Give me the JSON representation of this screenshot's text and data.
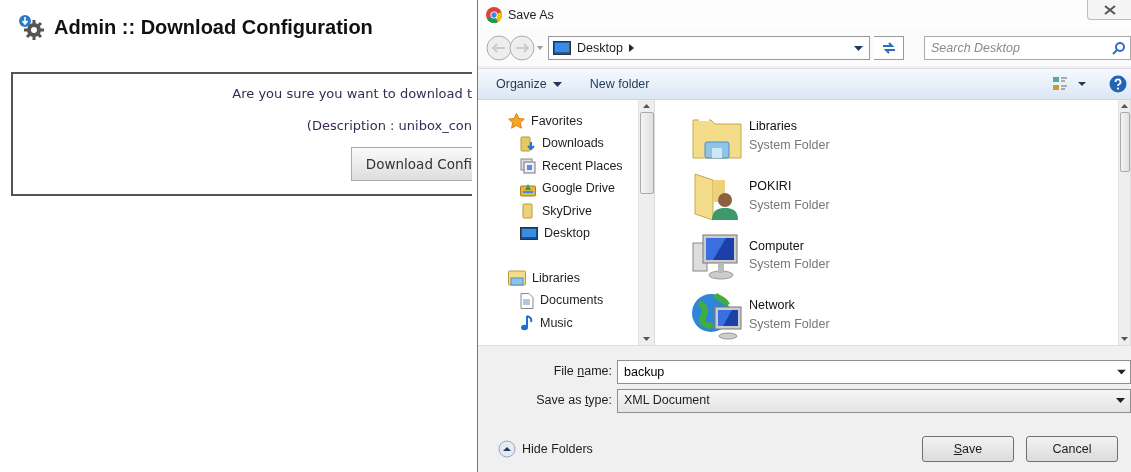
{
  "page": {
    "title": "Admin :: Download Configuration",
    "prompt": "Are you sure you want to download t",
    "description": "(Description : unibox_con",
    "download_button": "Download Confi"
  },
  "dialog": {
    "title": "Save As",
    "address": "Desktop",
    "search": {
      "placeholder": "Search Desktop"
    },
    "toolbar": [
      {
        "label": "Organize",
        "kind": "menu"
      },
      {
        "label": "New folder",
        "kind": "plain"
      }
    ],
    "nav": [
      {
        "label": "Favorites",
        "kind": "star",
        "children": [
          {
            "label": "Downloads",
            "kind": "downloads"
          },
          {
            "label": "Recent Places",
            "kind": "recent"
          },
          {
            "label": "Google Drive",
            "kind": "drive"
          },
          {
            "label": "SkyDrive",
            "kind": "folder"
          },
          {
            "label": "Desktop",
            "kind": "desktop"
          }
        ]
      },
      {
        "label": "Libraries",
        "kind": "libraries",
        "children": [
          {
            "label": "Documents",
            "kind": "document"
          },
          {
            "label": "Music",
            "kind": "music"
          }
        ]
      }
    ],
    "items": [
      {
        "name": "Libraries",
        "type": "System Folder",
        "kind": "libraries"
      },
      {
        "name": "POKIRI",
        "type": "System Folder",
        "kind": "user"
      },
      {
        "name": "Computer",
        "type": "System Folder",
        "kind": "computer"
      },
      {
        "name": "Network",
        "type": "System Folder",
        "kind": "network"
      }
    ],
    "file_name": {
      "label_parts": [
        {
          "text": "File ",
          "underline": false
        },
        {
          "text": "n",
          "underline": true
        },
        {
          "text": "ame:",
          "underline": false
        }
      ],
      "value": "backup"
    },
    "save_type": {
      "label_parts": [
        {
          "text": "Save as ",
          "underline": false
        },
        {
          "text": "t",
          "underline": true
        },
        {
          "text": "ype:",
          "underline": false
        }
      ],
      "value": "XML Document"
    },
    "hide_folders": "Hide Folders",
    "buttons": [
      {
        "kind": "save",
        "label_parts": [
          {
            "text": "S",
            "underline": true
          },
          {
            "text": "ave",
            "underline": false
          }
        ]
      },
      {
        "kind": "cancel",
        "label_parts": [
          {
            "text": "Cancel",
            "underline": false
          }
        ]
      }
    ]
  }
}
